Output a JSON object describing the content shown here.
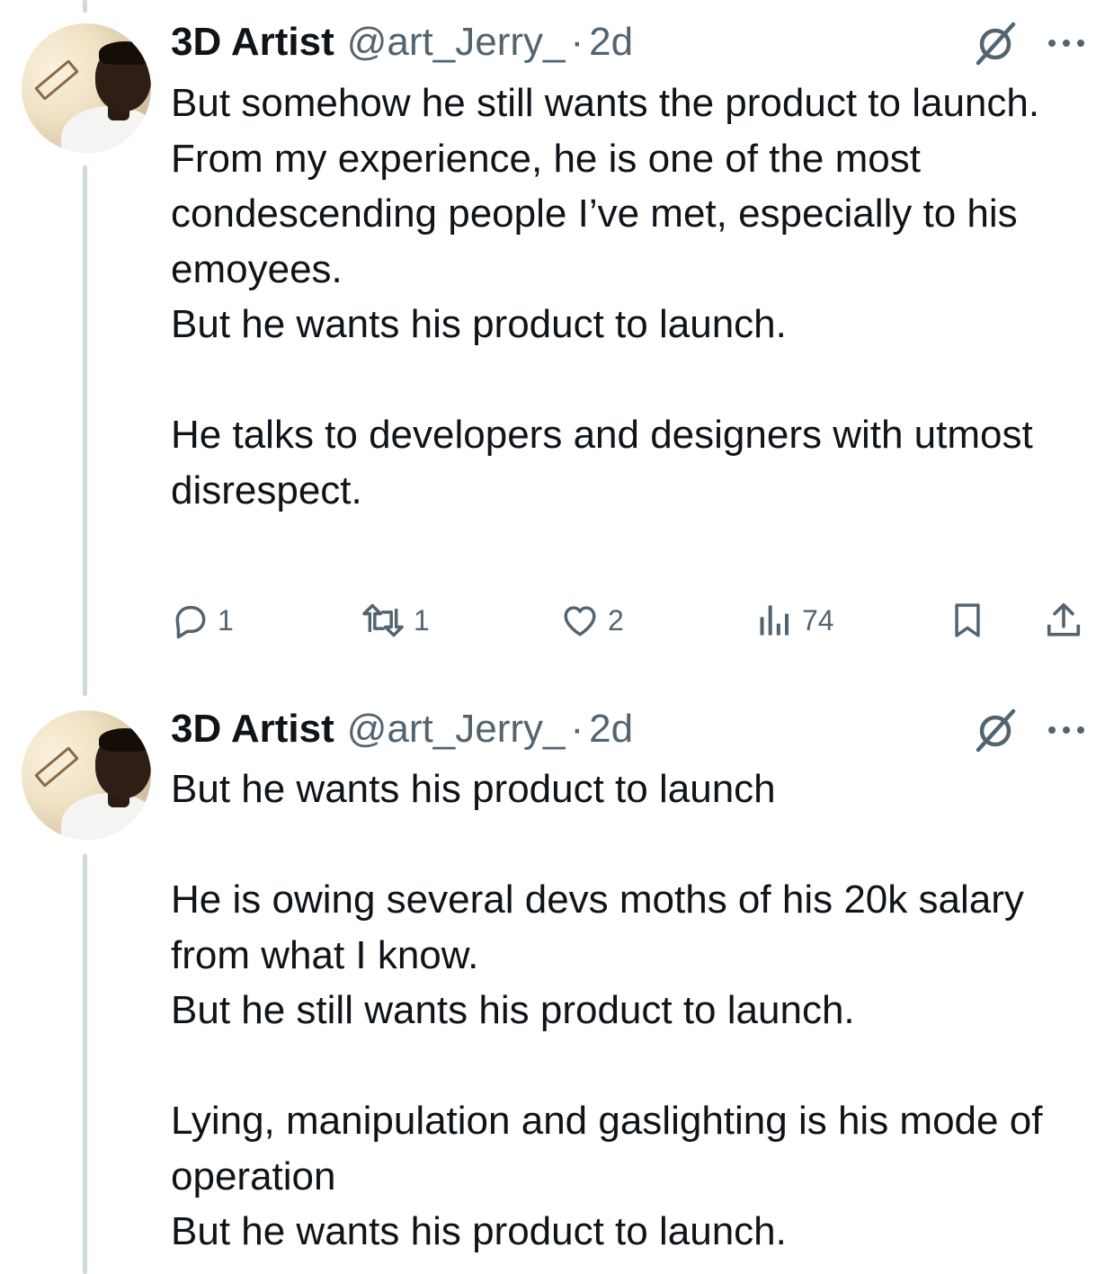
{
  "tweets": [
    {
      "author_name": "3D Artist",
      "author_handle": "@art_Jerry_",
      "separator": "·",
      "timestamp": "2d",
      "text": "But somehow he still wants the product to launch.\nFrom my experience, he is one of the most condescending people I’ve met, especially to his emoyees.\nBut he wants his product to launch.\n\nHe talks to developers and designers with utmost disrespect.",
      "stats": {
        "replies": "1",
        "reposts": "1",
        "likes": "2",
        "views": "74"
      }
    },
    {
      "author_name": "3D Artist",
      "author_handle": "@art_Jerry_",
      "separator": "·",
      "timestamp": "2d",
      "text": "But he wants his product to launch\n\nHe is owing several devs moths of his 20k salary from what I know.\nBut he still wants his product to launch.\n\nLying, manipulation and gaslighting is his mode of operation\nBut he wants his product to launch."
    }
  ],
  "icons": {
    "reply": "reply-icon",
    "repost": "repost-icon",
    "like": "like-icon",
    "views": "views-icon",
    "bookmark": "bookmark-icon",
    "share": "share-icon",
    "grok": "grok-icon",
    "more": "more-icon"
  },
  "colors": {
    "text_primary": "#0f1419",
    "text_secondary": "#536471",
    "thread_line": "#cfd9de"
  }
}
